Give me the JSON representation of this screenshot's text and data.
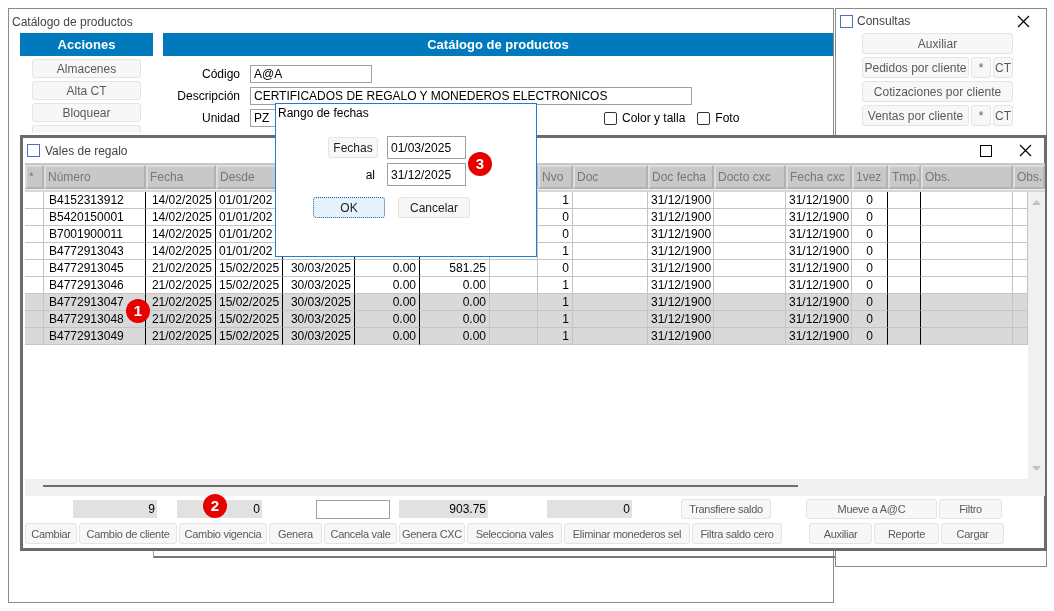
{
  "main_window": {
    "title": "Catálogo de productos",
    "actions_header": "Acciones",
    "actions": [
      "Almacenes",
      "Alta CT",
      "Bloquear"
    ],
    "catalog_header": "Catálogo de productos",
    "fields": [
      {
        "label": "Código",
        "value": "A@A"
      },
      {
        "label": "Descripción",
        "value": "CERTIFICADOS DE REGALO Y MONEDEROS ELECTRONICOS"
      },
      {
        "label": "Unidad",
        "value": "PZ"
      }
    ],
    "checkboxes": [
      {
        "label": "Color y talla",
        "checked": false
      },
      {
        "label": "Foto",
        "checked": false
      }
    ]
  },
  "consultas_window": {
    "title": "Consultas",
    "rows": [
      [
        "Auxiliar"
      ],
      [
        "Pedidos por cliente",
        "*",
        "CT"
      ],
      [
        "Cotizaciones por cliente"
      ],
      [
        "Ventas por cliente",
        "*",
        "CT"
      ]
    ]
  },
  "vales_window": {
    "title": "Vales de regalo",
    "columns": [
      "*",
      "Número",
      "Fecha",
      "Desde",
      null,
      null,
      null,
      null,
      "Nvo",
      "Doc",
      "Doc fecha",
      "Docto cxc",
      "Fecha cxc",
      "1vez",
      "Tmp.",
      "Obs.",
      "Obs."
    ],
    "rows": [
      {
        "selected": false,
        "cells": [
          null,
          "B4152313912",
          "14/02/2025",
          "01/01/202",
          null,
          null,
          null,
          null,
          "1",
          null,
          "31/12/1900",
          null,
          "31/12/1900",
          "0",
          null,
          null,
          null
        ]
      },
      {
        "selected": false,
        "cells": [
          null,
          "B5420150001",
          "14/02/2025",
          "01/01/202",
          null,
          null,
          null,
          null,
          "0",
          null,
          "31/12/1900",
          null,
          "31/12/1900",
          "0",
          null,
          null,
          null
        ]
      },
      {
        "selected": false,
        "cells": [
          null,
          "B7001900011",
          "14/02/2025",
          "01/01/202",
          null,
          null,
          null,
          null,
          "0",
          null,
          "31/12/1900",
          null,
          "31/12/1900",
          "0",
          null,
          null,
          null
        ]
      },
      {
        "selected": false,
        "cells": [
          null,
          "B4772913043",
          "14/02/2025",
          "01/01/202",
          null,
          null,
          null,
          null,
          "1",
          null,
          "31/12/1900",
          null,
          "31/12/1900",
          "0",
          null,
          null,
          null
        ]
      },
      {
        "selected": false,
        "cells": [
          null,
          "B4772913045",
          "21/02/2025",
          "15/02/2025",
          "30/03/2025",
          "0.00",
          "581.25",
          null,
          "0",
          null,
          "31/12/1900",
          null,
          "31/12/1900",
          "0",
          null,
          null,
          null
        ]
      },
      {
        "selected": false,
        "cells": [
          null,
          "B4772913046",
          "21/02/2025",
          "15/02/2025",
          "30/03/2025",
          "0.00",
          "0.00",
          null,
          "1",
          null,
          "31/12/1900",
          null,
          "31/12/1900",
          "0",
          null,
          null,
          null
        ]
      },
      {
        "selected": true,
        "cells": [
          null,
          "B4772913047",
          "21/02/2025",
          "15/02/2025",
          "30/03/2025",
          "0.00",
          "0.00",
          null,
          "1",
          null,
          "31/12/1900",
          null,
          "31/12/1900",
          "0",
          null,
          null,
          null
        ]
      },
      {
        "selected": true,
        "cells": [
          null,
          "B4772913048",
          "21/02/2025",
          "15/02/2025",
          "30/03/2025",
          "0.00",
          "0.00",
          null,
          "1",
          null,
          "31/12/1900",
          null,
          "31/12/1900",
          "0",
          null,
          null,
          null
        ]
      },
      {
        "selected": true,
        "cells": [
          null,
          "B4772913049",
          "21/02/2025",
          "15/02/2025",
          "30/03/2025",
          "0.00",
          "0.00",
          null,
          "1",
          null,
          "31/12/1900",
          null,
          "31/12/1900",
          "0",
          null,
          null,
          null
        ]
      }
    ],
    "footer_top": [
      {
        "kind": "readout",
        "value": "9"
      },
      {
        "kind": "readout",
        "value": "0"
      },
      {
        "kind": "input"
      },
      {
        "kind": "readout",
        "value": "903.75"
      },
      {
        "kind": "readout",
        "value": "0"
      },
      {
        "kind": "button",
        "value": "Transfiere saldo"
      },
      {
        "kind": "button",
        "value": "Mueve a A@C"
      },
      {
        "kind": "button",
        "value": "Filtro"
      }
    ],
    "footer_buttons": [
      "Cambiar",
      "Cambio de cliente",
      "Cambio vigencia",
      "Genera",
      "Cancela vale",
      "Genera CXC",
      "Selecciona vales",
      "Eliminar monederos sel",
      "Filtra saldo cero",
      "Auxiliar",
      "Reporte",
      "Cargar"
    ]
  },
  "date_dialog": {
    "title": "Rango de fechas",
    "range_button": "Fechas",
    "from": "01/03/2025",
    "to_label": "al",
    "to": "31/12/2025",
    "buttons": [
      {
        "label": "OK",
        "focused": true
      },
      {
        "label": "Cancelar",
        "focused": false
      }
    ]
  },
  "annotations": [
    "1",
    "2",
    "3"
  ]
}
